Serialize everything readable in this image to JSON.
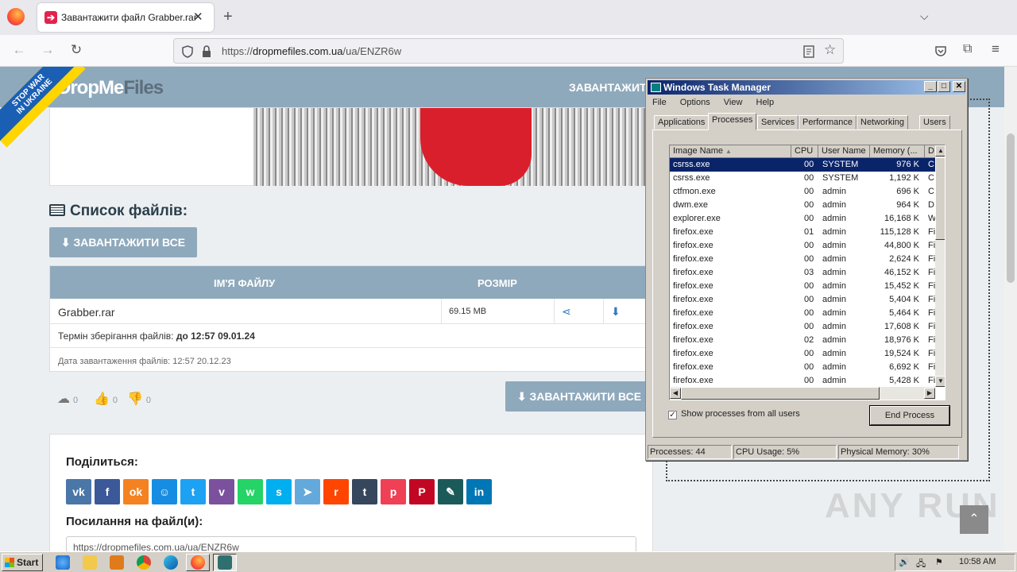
{
  "browser": {
    "tab_title": "Завантажити файл Grabber.rar",
    "tab_close": "✕",
    "new_tab": "+",
    "tab_list": "⌵",
    "url_prefix": "https://",
    "url_host": "dropmefiles.com.ua",
    "url_path": "/ua/ENZR6w",
    "back": "←",
    "forward": "→",
    "reload": "↻"
  },
  "site": {
    "logo_part1": "DropMe",
    "logo_part2": "Files",
    "banner_line1": "STOP WAR",
    "banner_line2": "IN UKRAINE",
    "header_upload": "ЗАВАНТАЖИТИ",
    "files_title": "Список файлів:",
    "download_all": "⬇ ЗАВАНТАЖИТИ ВСЕ",
    "col_name": "ІМ'Я ФАЙЛУ",
    "col_size": "РОЗМІР",
    "file_name": "Grabber.rar",
    "file_size": "69.15 MB",
    "expiry_label": "Термін зберігання файлів:",
    "expiry_value": "до 12:57 09.01.24",
    "upload_date": "Дата завантаження файлів: 12:57 20.12.23",
    "downloads_count": "0",
    "likes_count": "0",
    "dislikes_count": "0",
    "share_title": "Поділиться:",
    "link_title": "Посилання на файл(и):",
    "link_value": "https://dropmefiles.com.ua/ua/ENZR6w",
    "social": [
      "vk",
      "f",
      "ok",
      "☺",
      "t",
      "v",
      "w",
      "s",
      "➤",
      "r",
      "t",
      "p",
      "P",
      "✎",
      "in"
    ],
    "watermark": "ANY RUN",
    "scroll_up": "⌃"
  },
  "task_manager": {
    "title": "Windows Task Manager",
    "menu": [
      "File",
      "Options",
      "View",
      "Help"
    ],
    "tabs": [
      "Applications",
      "Processes",
      "Services",
      "Performance",
      "Networking",
      "Users"
    ],
    "active_tab": "Processes",
    "columns": [
      "Image Name",
      "CPU",
      "User Name",
      "Memory (...",
      "D"
    ],
    "processes": [
      {
        "name": "csrss.exe",
        "cpu": "00",
        "user": "SYSTEM",
        "mem": "976 K",
        "d": "C"
      },
      {
        "name": "csrss.exe",
        "cpu": "00",
        "user": "SYSTEM",
        "mem": "1,192 K",
        "d": "C"
      },
      {
        "name": "ctfmon.exe",
        "cpu": "00",
        "user": "admin",
        "mem": "696 K",
        "d": "C"
      },
      {
        "name": "dwm.exe",
        "cpu": "00",
        "user": "admin",
        "mem": "964 K",
        "d": "D"
      },
      {
        "name": "explorer.exe",
        "cpu": "00",
        "user": "admin",
        "mem": "16,168 K",
        "d": "W"
      },
      {
        "name": "firefox.exe",
        "cpu": "01",
        "user": "admin",
        "mem": "115,128 K",
        "d": "Fi"
      },
      {
        "name": "firefox.exe",
        "cpu": "00",
        "user": "admin",
        "mem": "44,800 K",
        "d": "Fi"
      },
      {
        "name": "firefox.exe",
        "cpu": "00",
        "user": "admin",
        "mem": "2,624 K",
        "d": "Fi"
      },
      {
        "name": "firefox.exe",
        "cpu": "03",
        "user": "admin",
        "mem": "46,152 K",
        "d": "Fi"
      },
      {
        "name": "firefox.exe",
        "cpu": "00",
        "user": "admin",
        "mem": "15,452 K",
        "d": "Fi"
      },
      {
        "name": "firefox.exe",
        "cpu": "00",
        "user": "admin",
        "mem": "5,404 K",
        "d": "Fi"
      },
      {
        "name": "firefox.exe",
        "cpu": "00",
        "user": "admin",
        "mem": "5,464 K",
        "d": "Fi"
      },
      {
        "name": "firefox.exe",
        "cpu": "00",
        "user": "admin",
        "mem": "17,608 K",
        "d": "Fi"
      },
      {
        "name": "firefox.exe",
        "cpu": "02",
        "user": "admin",
        "mem": "18,976 K",
        "d": "Fi"
      },
      {
        "name": "firefox.exe",
        "cpu": "00",
        "user": "admin",
        "mem": "19,524 K",
        "d": "Fi"
      },
      {
        "name": "firefox.exe",
        "cpu": "00",
        "user": "admin",
        "mem": "6,692 K",
        "d": "Fi"
      },
      {
        "name": "firefox.exe",
        "cpu": "00",
        "user": "admin",
        "mem": "5,428 K",
        "d": "Fi"
      }
    ],
    "show_all_label": "Show processes from all users",
    "end_process": "End Process",
    "status_processes": "Processes: 44",
    "status_cpu": "CPU Usage: 5%",
    "status_memory": "Physical Memory: 30%"
  },
  "taskbar": {
    "start": "Start",
    "clock": "10:58 AM"
  }
}
